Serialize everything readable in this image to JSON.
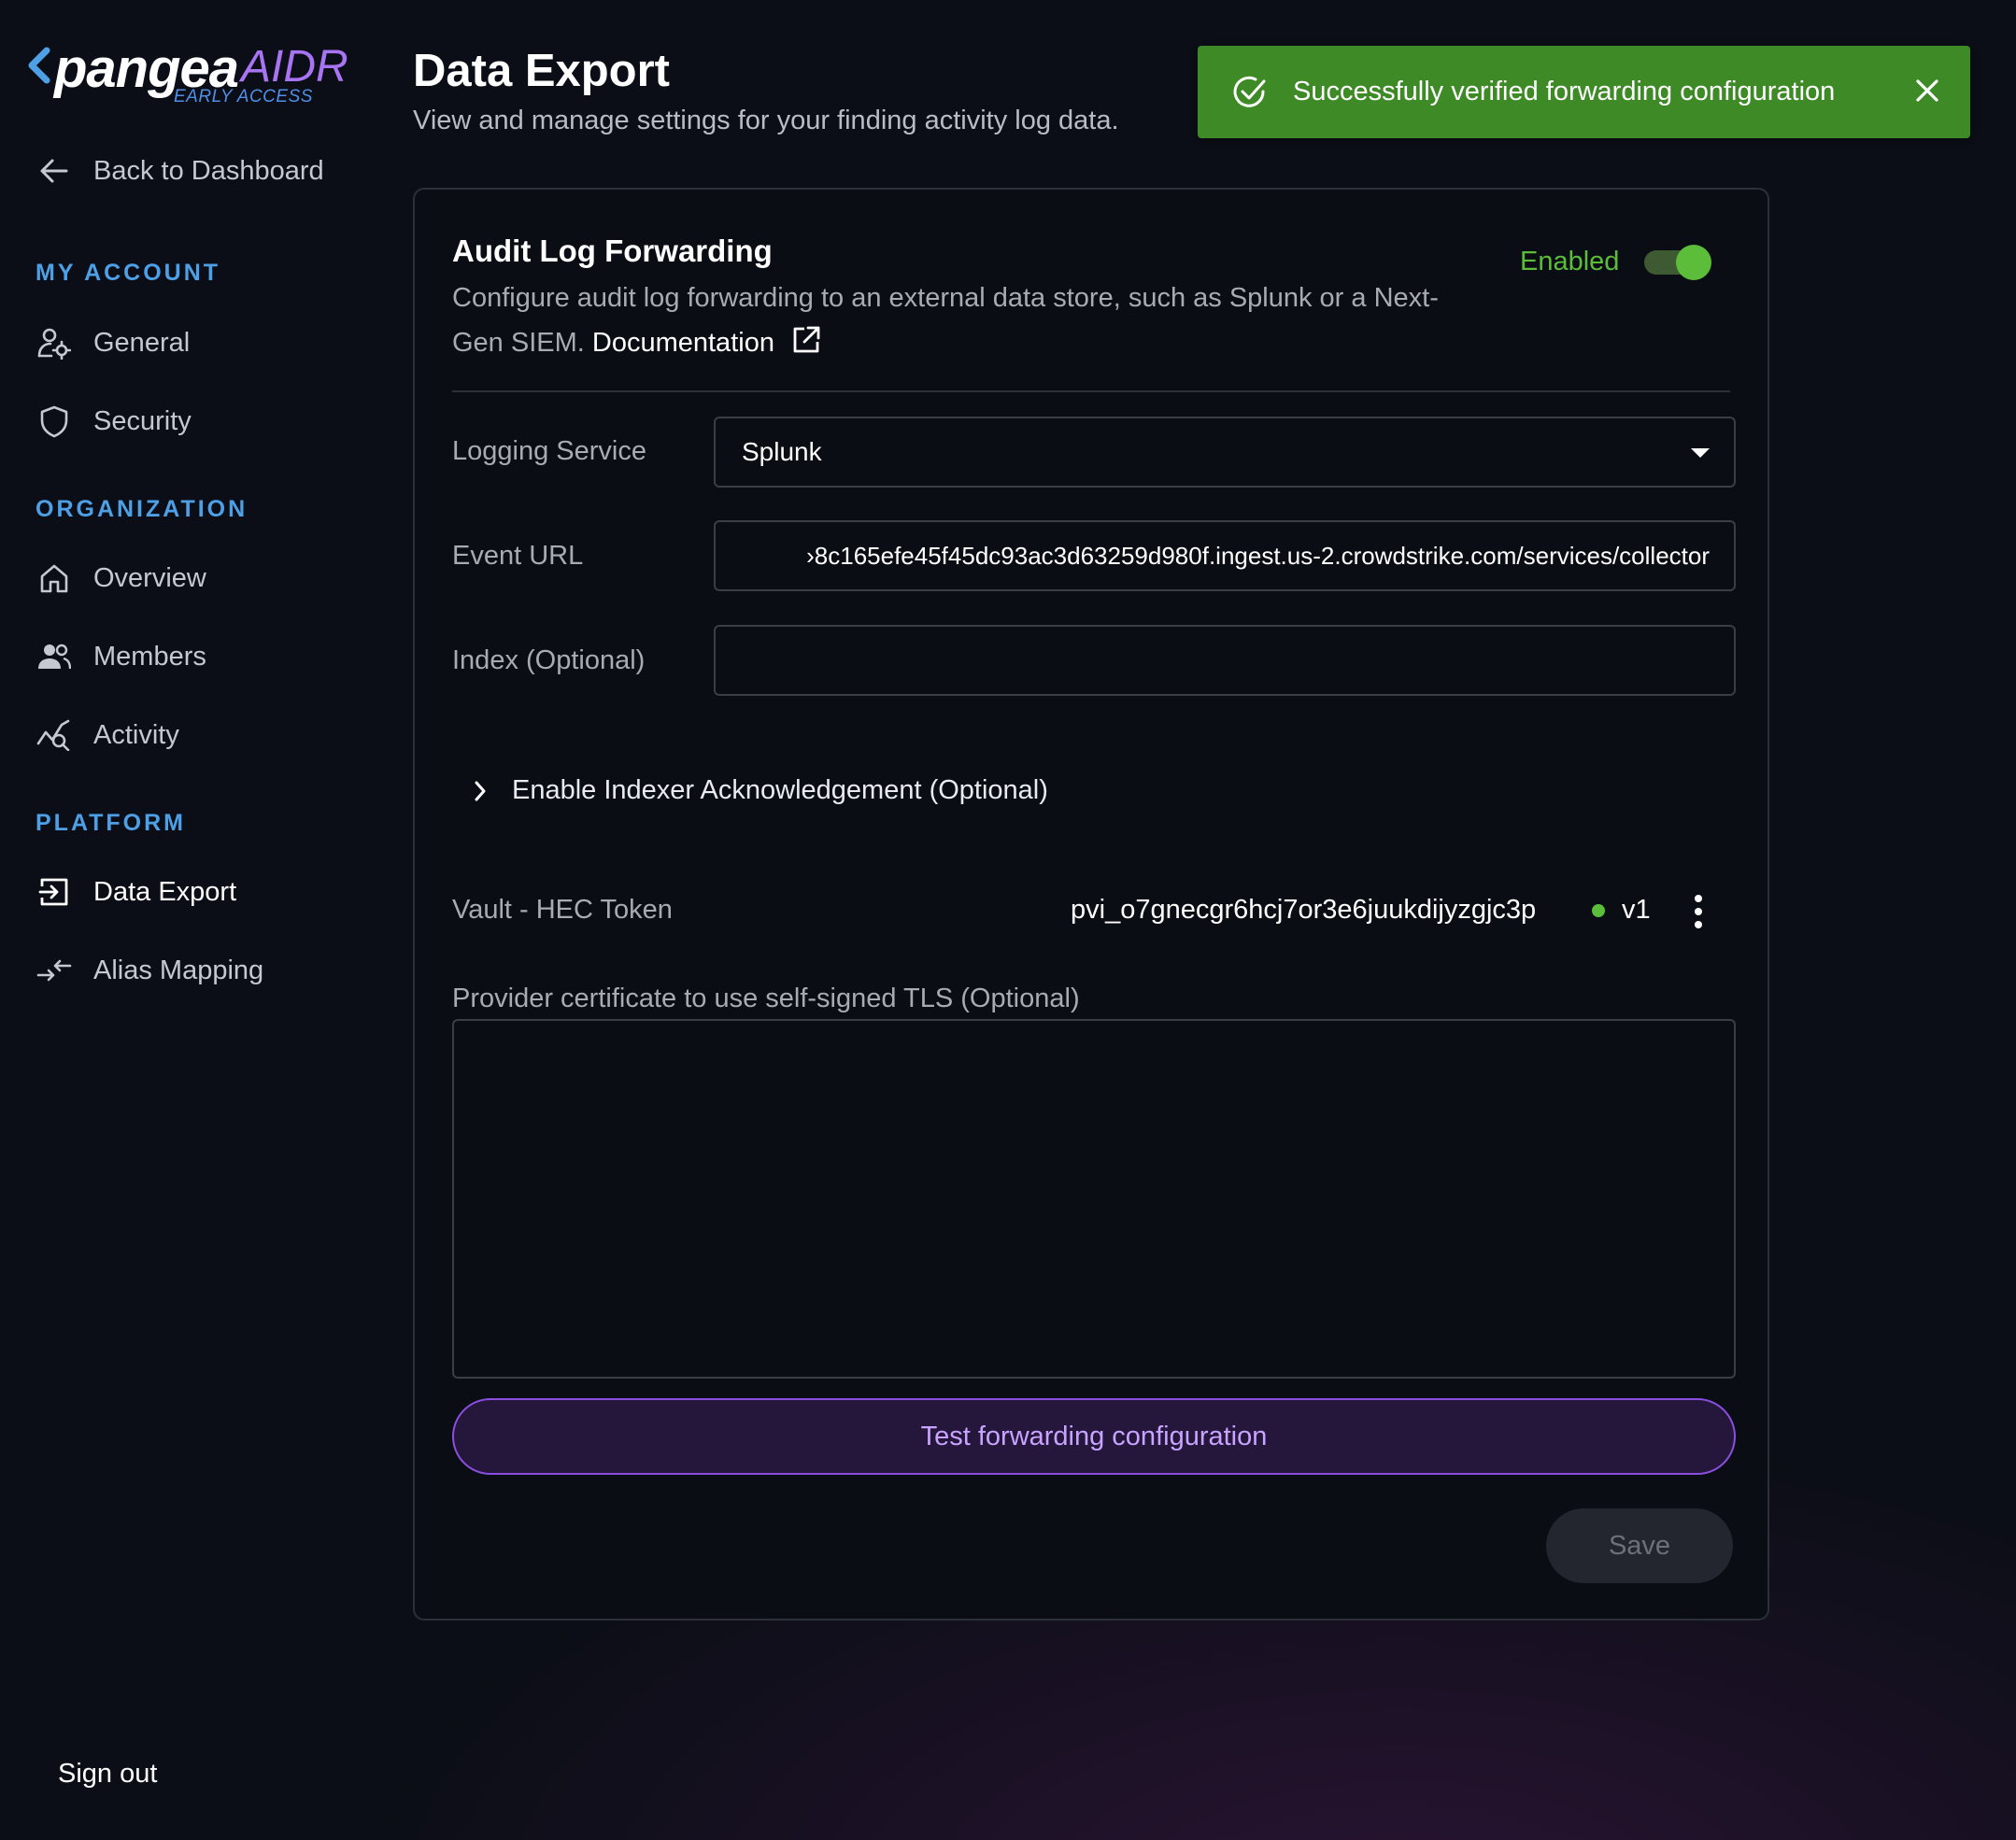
{
  "logo": {
    "word": "pangea",
    "product": "AIDR",
    "badge": "EARLY ACCESS"
  },
  "sidebar": {
    "back_label": "Back to Dashboard",
    "sections": {
      "my_account": "MY ACCOUNT",
      "organization": "ORGANIZATION",
      "platform": "PLATFORM"
    },
    "items": {
      "general": "General",
      "security": "Security",
      "overview": "Overview",
      "members": "Members",
      "activity": "Activity",
      "data_export": "Data Export",
      "alias_mapping": "Alias Mapping"
    },
    "active_item": "Data Export",
    "sign_out": "Sign out"
  },
  "header": {
    "title": "Data Export",
    "subtitle": "View and manage settings for your finding activity log data."
  },
  "toast": {
    "message": "Successfully verified forwarding configuration",
    "color": "#3d8a26"
  },
  "card": {
    "title": "Audit Log Forwarding",
    "description": "Configure audit log forwarding to an external data store, such as Splunk or a Next-Gen SIEM.",
    "doc_link": "Documentation",
    "enabled_label": "Enabled",
    "enabled": true,
    "fields": {
      "logging_service_label": "Logging Service",
      "logging_service_value": "Splunk",
      "event_url_label": "Event URL",
      "event_url_value": "›8c165efe45f45dc93ac3d63259d980f.ingest.us-2.crowdstrike.com/services/collector",
      "index_label": "Index (Optional)",
      "index_value": ""
    },
    "expander_label": "Enable Indexer Acknowledgement (Optional)",
    "vault": {
      "label": "Vault - HEC Token",
      "value": "pvi_o7gnecgr6hcj7or3e6juukdijyzgjc3p",
      "version": "v1",
      "status_color": "#5bbd3a"
    },
    "cert_label": "Provider certificate to use self-signed TLS (Optional)",
    "cert_value": "",
    "test_button": "Test forwarding configuration",
    "save_button": "Save"
  },
  "colors": {
    "accent_purple": "#8a4fe0",
    "success_green": "#5bbd3a",
    "section_blue": "#4ea0e6"
  }
}
